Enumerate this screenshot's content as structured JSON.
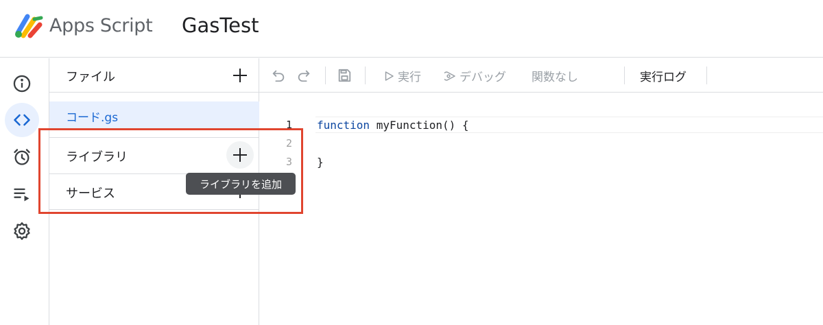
{
  "header": {
    "app_name": "Apps Script",
    "project_name": "GasTest"
  },
  "rail": {
    "items": [
      {
        "icon": "info-icon"
      },
      {
        "icon": "code-icon",
        "active": true
      },
      {
        "icon": "alarm-clock-icon"
      },
      {
        "icon": "playlist-icon"
      },
      {
        "icon": "gear-icon"
      }
    ]
  },
  "files_panel": {
    "files_label": "ファイル",
    "file_name": "コード.gs",
    "libraries_label": "ライブラリ",
    "services_label": "サービス",
    "tooltip": "ライブラリを追加"
  },
  "toolbar": {
    "run_label": "実行",
    "debug_label": "デバッグ",
    "function_select": "関数なし",
    "execution_log_label": "実行ログ"
  },
  "editor": {
    "lines": [
      {
        "number": "1",
        "keyword": "function",
        "text": " myFunction() {"
      },
      {
        "number": "2",
        "keyword": "",
        "text": ""
      },
      {
        "number": "3",
        "keyword": "",
        "text": "}"
      }
    ]
  },
  "colors": {
    "accent": "#1967d2",
    "active_bg": "#e8f0fe",
    "highlight_box": "#e0452f",
    "tooltip_bg": "#4d4f53"
  }
}
